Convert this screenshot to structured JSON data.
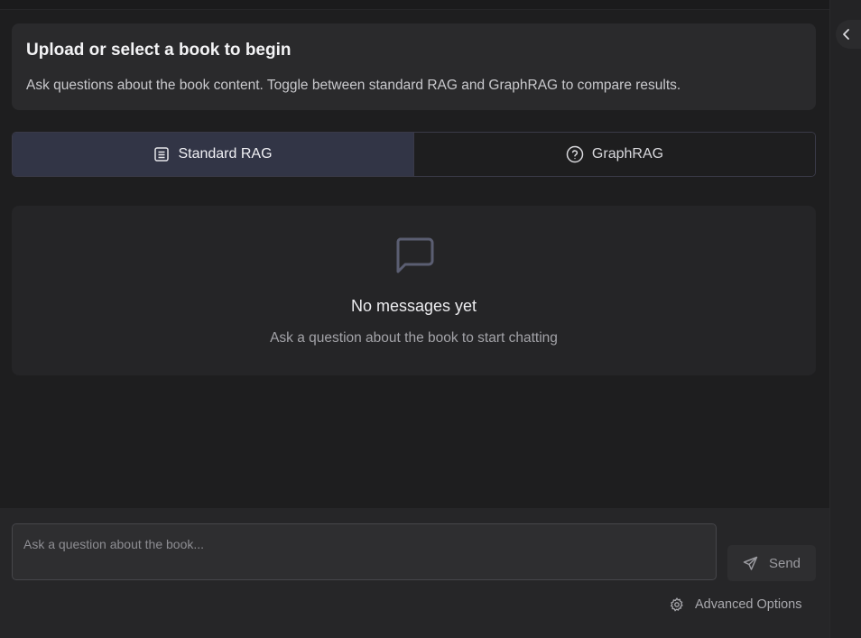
{
  "header": {
    "title": "Upload or select a book to begin",
    "subtitle": "Ask questions about the book content. Toggle between standard RAG and GraphRAG to compare results."
  },
  "mode_toggle": {
    "options": [
      {
        "label": "Standard RAG",
        "icon": "document-icon",
        "active": true
      },
      {
        "label": "GraphRAG",
        "icon": "question-circle-icon",
        "active": false
      }
    ]
  },
  "empty_state": {
    "icon": "message-square-icon",
    "title": "No messages yet",
    "subtitle": "Ask a question about the book to start chatting"
  },
  "composer": {
    "placeholder": "Ask a question about the book...",
    "value": "",
    "send_label": "Send",
    "send_icon": "send-icon",
    "advanced_label": "Advanced Options",
    "advanced_icon": "gear-icon"
  },
  "sidebar": {
    "toggle_icon": "chevron-left-icon"
  },
  "colors": {
    "background": "#1e1e1f",
    "card": "#2a2a2c",
    "active_toggle": "#323546",
    "border_accent": "#3a3a48"
  }
}
